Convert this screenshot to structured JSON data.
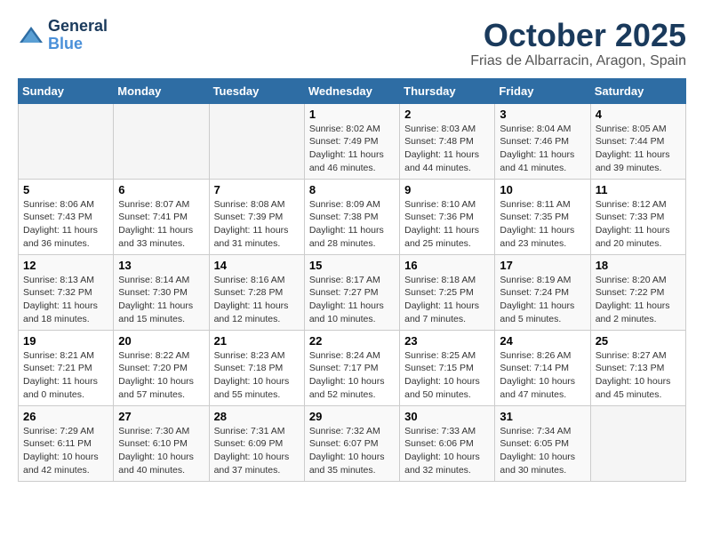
{
  "logo": {
    "line1": "General",
    "line2": "Blue"
  },
  "title": "October 2025",
  "location": "Frias de Albarracin, Aragon, Spain",
  "days_of_week": [
    "Sunday",
    "Monday",
    "Tuesday",
    "Wednesday",
    "Thursday",
    "Friday",
    "Saturday"
  ],
  "weeks": [
    {
      "days": [
        {
          "num": "",
          "info": ""
        },
        {
          "num": "",
          "info": ""
        },
        {
          "num": "",
          "info": ""
        },
        {
          "num": "1",
          "info": "Sunrise: 8:02 AM\nSunset: 7:49 PM\nDaylight: 11 hours\nand 46 minutes."
        },
        {
          "num": "2",
          "info": "Sunrise: 8:03 AM\nSunset: 7:48 PM\nDaylight: 11 hours\nand 44 minutes."
        },
        {
          "num": "3",
          "info": "Sunrise: 8:04 AM\nSunset: 7:46 PM\nDaylight: 11 hours\nand 41 minutes."
        },
        {
          "num": "4",
          "info": "Sunrise: 8:05 AM\nSunset: 7:44 PM\nDaylight: 11 hours\nand 39 minutes."
        }
      ]
    },
    {
      "days": [
        {
          "num": "5",
          "info": "Sunrise: 8:06 AM\nSunset: 7:43 PM\nDaylight: 11 hours\nand 36 minutes."
        },
        {
          "num": "6",
          "info": "Sunrise: 8:07 AM\nSunset: 7:41 PM\nDaylight: 11 hours\nand 33 minutes."
        },
        {
          "num": "7",
          "info": "Sunrise: 8:08 AM\nSunset: 7:39 PM\nDaylight: 11 hours\nand 31 minutes."
        },
        {
          "num": "8",
          "info": "Sunrise: 8:09 AM\nSunset: 7:38 PM\nDaylight: 11 hours\nand 28 minutes."
        },
        {
          "num": "9",
          "info": "Sunrise: 8:10 AM\nSunset: 7:36 PM\nDaylight: 11 hours\nand 25 minutes."
        },
        {
          "num": "10",
          "info": "Sunrise: 8:11 AM\nSunset: 7:35 PM\nDaylight: 11 hours\nand 23 minutes."
        },
        {
          "num": "11",
          "info": "Sunrise: 8:12 AM\nSunset: 7:33 PM\nDaylight: 11 hours\nand 20 minutes."
        }
      ]
    },
    {
      "days": [
        {
          "num": "12",
          "info": "Sunrise: 8:13 AM\nSunset: 7:32 PM\nDaylight: 11 hours\nand 18 minutes."
        },
        {
          "num": "13",
          "info": "Sunrise: 8:14 AM\nSunset: 7:30 PM\nDaylight: 11 hours\nand 15 minutes."
        },
        {
          "num": "14",
          "info": "Sunrise: 8:16 AM\nSunset: 7:28 PM\nDaylight: 11 hours\nand 12 minutes."
        },
        {
          "num": "15",
          "info": "Sunrise: 8:17 AM\nSunset: 7:27 PM\nDaylight: 11 hours\nand 10 minutes."
        },
        {
          "num": "16",
          "info": "Sunrise: 8:18 AM\nSunset: 7:25 PM\nDaylight: 11 hours\nand 7 minutes."
        },
        {
          "num": "17",
          "info": "Sunrise: 8:19 AM\nSunset: 7:24 PM\nDaylight: 11 hours\nand 5 minutes."
        },
        {
          "num": "18",
          "info": "Sunrise: 8:20 AM\nSunset: 7:22 PM\nDaylight: 11 hours\nand 2 minutes."
        }
      ]
    },
    {
      "days": [
        {
          "num": "19",
          "info": "Sunrise: 8:21 AM\nSunset: 7:21 PM\nDaylight: 11 hours\nand 0 minutes."
        },
        {
          "num": "20",
          "info": "Sunrise: 8:22 AM\nSunset: 7:20 PM\nDaylight: 10 hours\nand 57 minutes."
        },
        {
          "num": "21",
          "info": "Sunrise: 8:23 AM\nSunset: 7:18 PM\nDaylight: 10 hours\nand 55 minutes."
        },
        {
          "num": "22",
          "info": "Sunrise: 8:24 AM\nSunset: 7:17 PM\nDaylight: 10 hours\nand 52 minutes."
        },
        {
          "num": "23",
          "info": "Sunrise: 8:25 AM\nSunset: 7:15 PM\nDaylight: 10 hours\nand 50 minutes."
        },
        {
          "num": "24",
          "info": "Sunrise: 8:26 AM\nSunset: 7:14 PM\nDaylight: 10 hours\nand 47 minutes."
        },
        {
          "num": "25",
          "info": "Sunrise: 8:27 AM\nSunset: 7:13 PM\nDaylight: 10 hours\nand 45 minutes."
        }
      ]
    },
    {
      "days": [
        {
          "num": "26",
          "info": "Sunrise: 7:29 AM\nSunset: 6:11 PM\nDaylight: 10 hours\nand 42 minutes."
        },
        {
          "num": "27",
          "info": "Sunrise: 7:30 AM\nSunset: 6:10 PM\nDaylight: 10 hours\nand 40 minutes."
        },
        {
          "num": "28",
          "info": "Sunrise: 7:31 AM\nSunset: 6:09 PM\nDaylight: 10 hours\nand 37 minutes."
        },
        {
          "num": "29",
          "info": "Sunrise: 7:32 AM\nSunset: 6:07 PM\nDaylight: 10 hours\nand 35 minutes."
        },
        {
          "num": "30",
          "info": "Sunrise: 7:33 AM\nSunset: 6:06 PM\nDaylight: 10 hours\nand 32 minutes."
        },
        {
          "num": "31",
          "info": "Sunrise: 7:34 AM\nSunset: 6:05 PM\nDaylight: 10 hours\nand 30 minutes."
        },
        {
          "num": "",
          "info": ""
        }
      ]
    }
  ]
}
